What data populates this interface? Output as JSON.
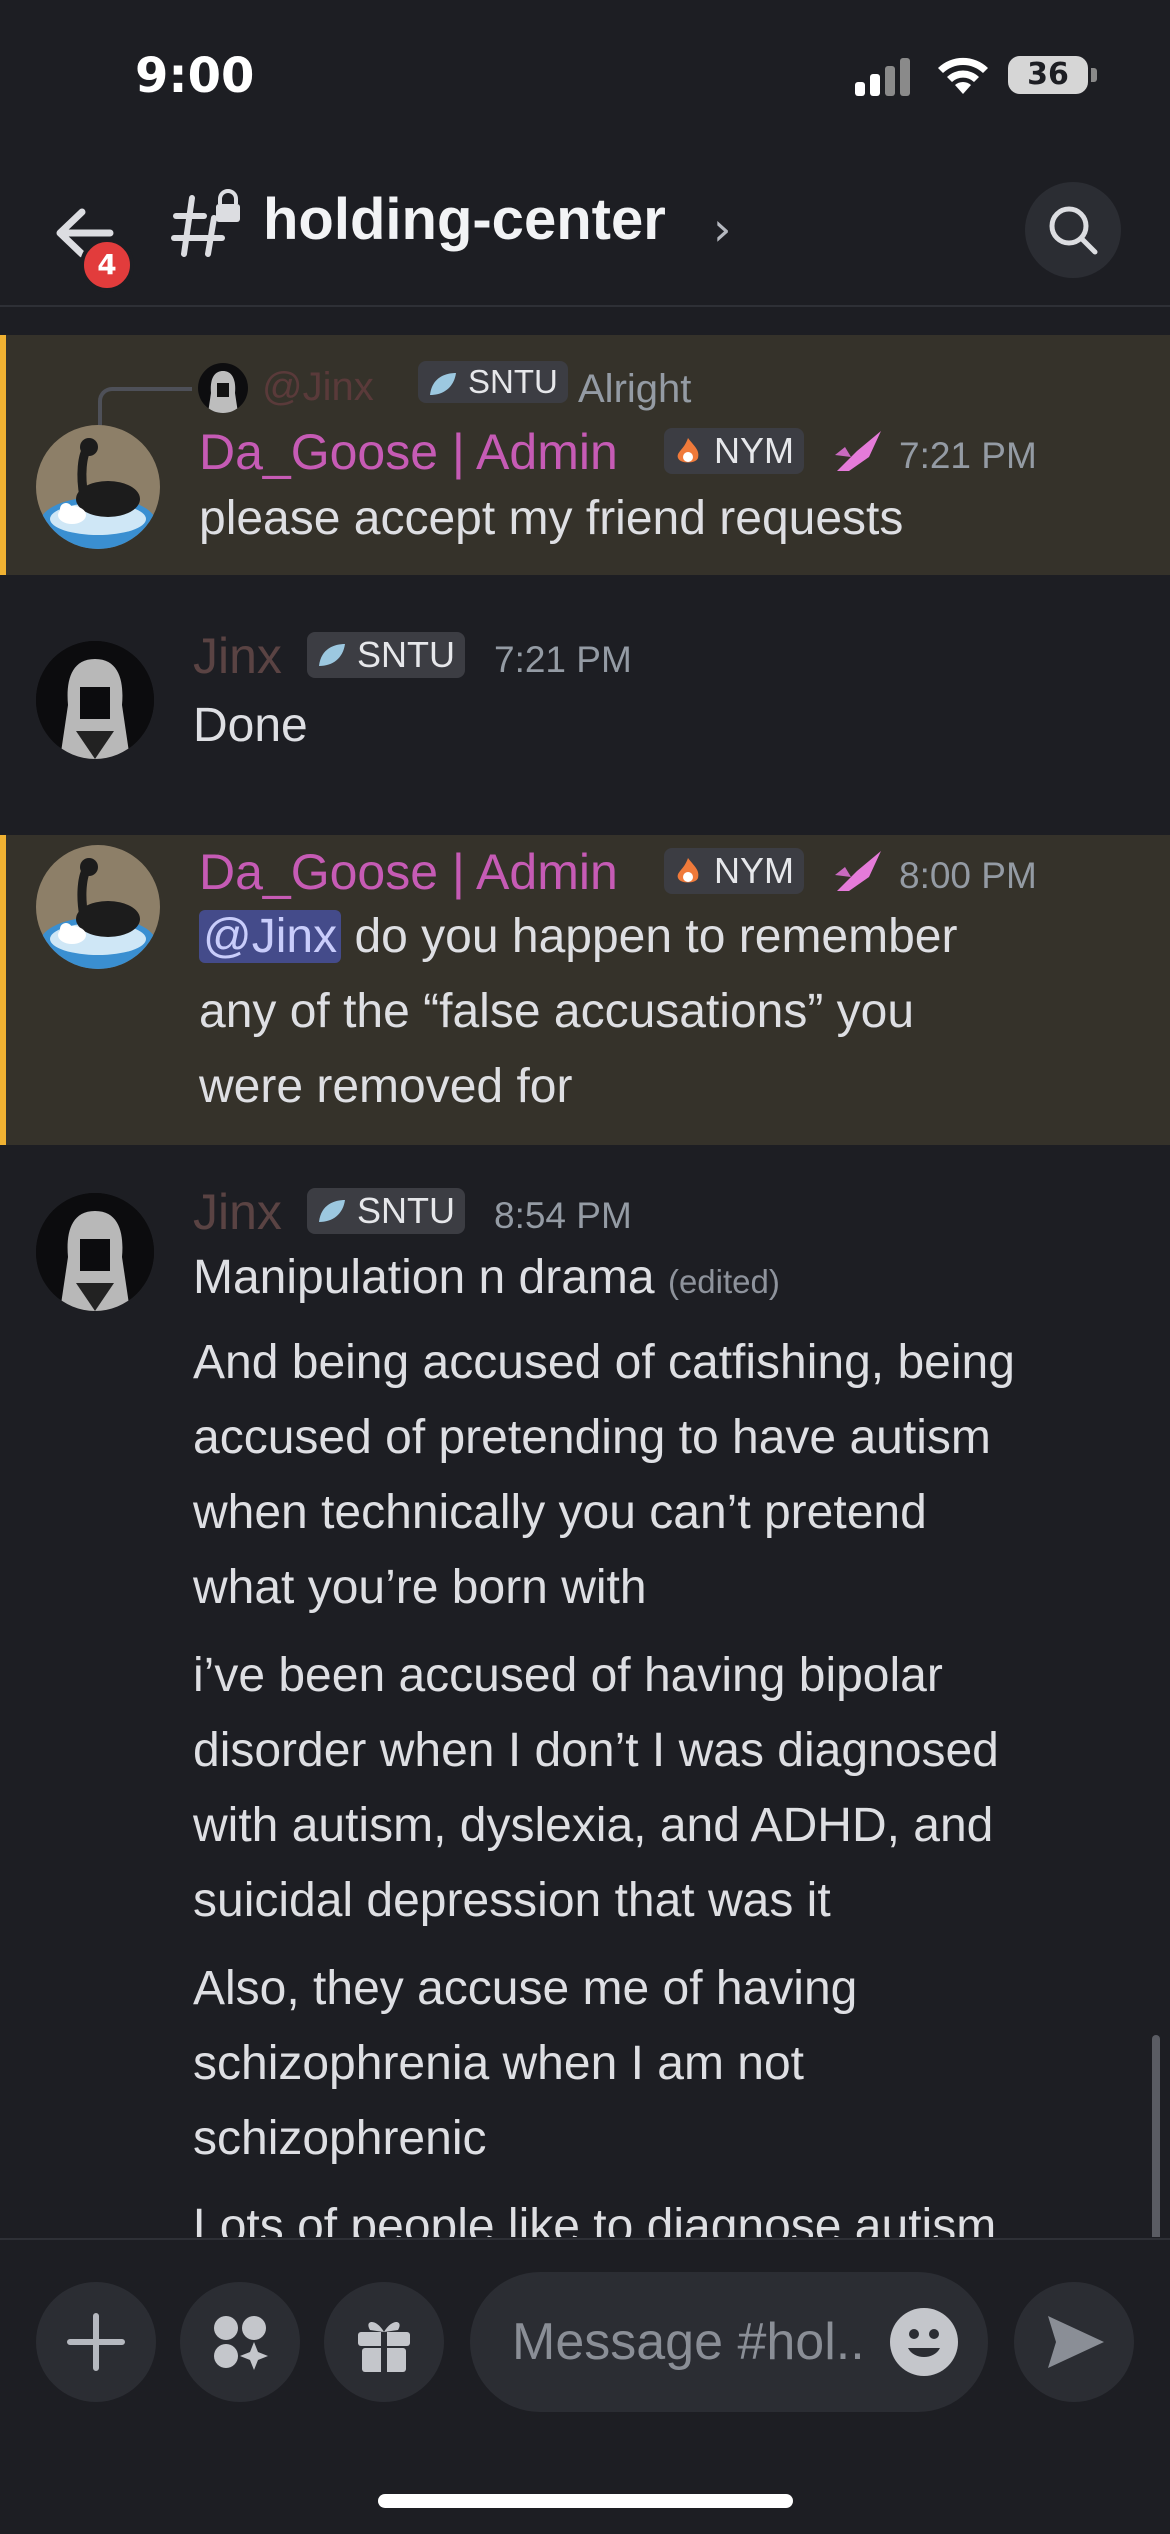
{
  "status_bar": {
    "time": "9:00",
    "battery": "36"
  },
  "header": {
    "back_badge": "4",
    "channel_name": "holding-center"
  },
  "messages": [
    {
      "reply": {
        "name": "@Jinx",
        "tag": "SNTU",
        "text": "Alright"
      },
      "author": "Da_Goose | Admin",
      "tag": "NYM",
      "time": "7:21 PM",
      "lines": [
        "please accept my friend requests"
      ]
    },
    {
      "author": "Jinx",
      "tag": "SNTU",
      "time": "7:21 PM",
      "lines": [
        "Done"
      ]
    },
    {
      "author": "Da_Goose | Admin",
      "tag": "NYM",
      "time": "8:00 PM",
      "mention": "@Jinx",
      "lines": [
        "do you happen to remember",
        "any of the “false accusations” you",
        "were removed for"
      ]
    },
    {
      "author": "Jinx",
      "tag": "SNTU",
      "time": "8:54 PM",
      "first_line": "Manipulation n drama",
      "edited": "(edited)",
      "paragraphs": [
        [
          "And being accused of catfishing, being",
          "accused of pretending to have autism",
          "when technically you can’t pretend",
          "what you’re born with"
        ],
        [
          "i’ve been accused of having bipolar",
          "disorder when I don’t I was diagnosed",
          "with autism, dyslexia, and ADHD, and",
          "suicidal depression that was it"
        ],
        [
          "Also, they accuse me of having",
          "schizophrenia when I am not",
          "schizophrenic"
        ],
        [
          "Lots of people like to diagnose autism"
        ]
      ]
    }
  ],
  "composer": {
    "placeholder": "Message #hol.."
  },
  "colors": {
    "admin_name": "#c65bb5",
    "jinx_name": "#5a4343",
    "highlight_border": "#f0b232",
    "mention_bg": "#444b8a"
  }
}
